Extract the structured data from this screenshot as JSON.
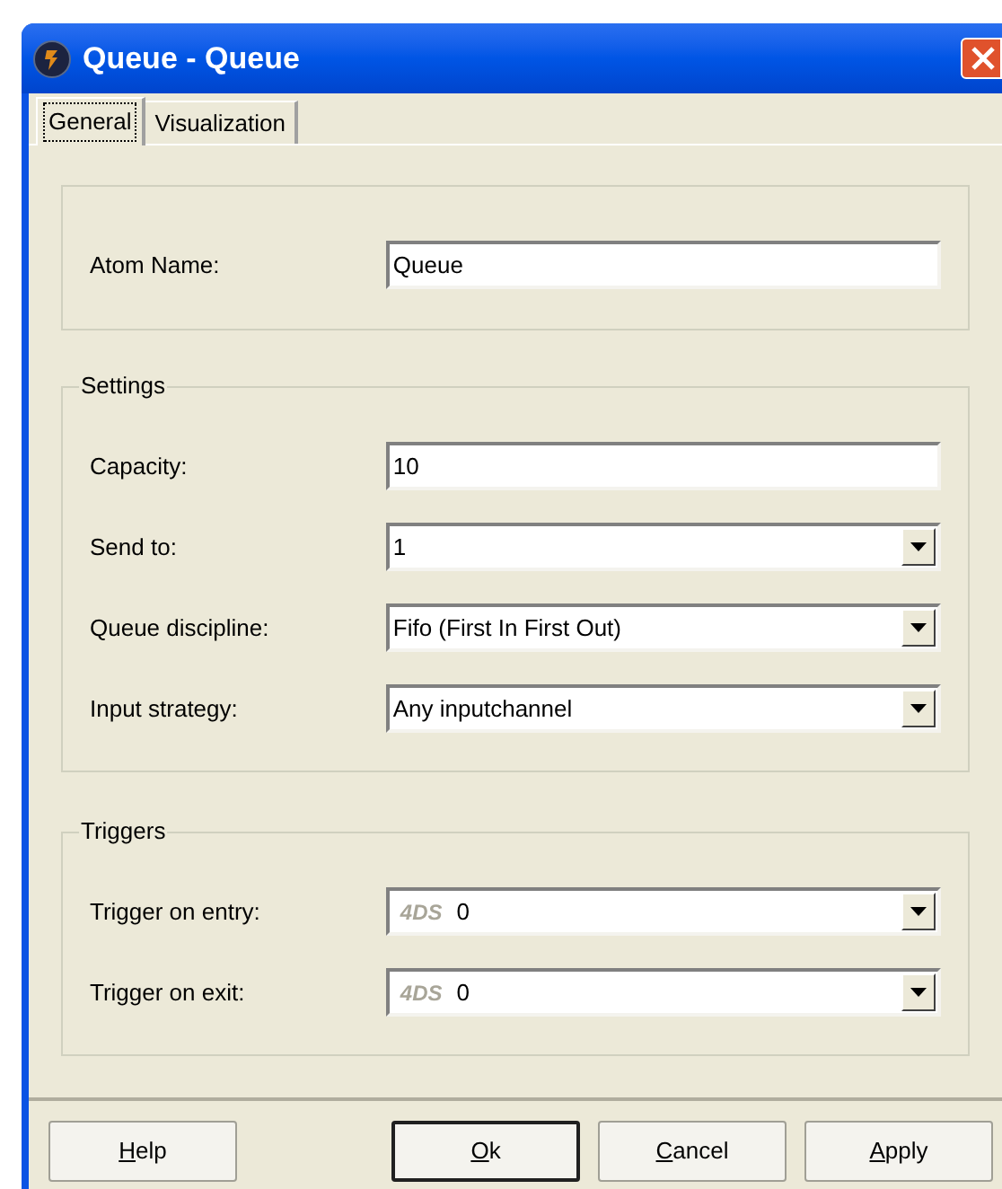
{
  "window": {
    "title": "Queue - Queue"
  },
  "tabs": [
    {
      "label": "General",
      "selected": true
    },
    {
      "label": "Visualization",
      "selected": false
    }
  ],
  "name_group": {
    "fields": [
      {
        "kind": "text",
        "label": "Atom Name:",
        "value": "Queue"
      }
    ]
  },
  "settings": {
    "title": "Settings",
    "fields": [
      {
        "kind": "text",
        "label": "Capacity:",
        "value": "10"
      },
      {
        "kind": "dropdown",
        "label": "Send to:",
        "value": "1"
      },
      {
        "kind": "dropdown",
        "label": "Queue discipline:",
        "value": "Fifo (First In First Out)"
      },
      {
        "kind": "dropdown",
        "label": "Input strategy:",
        "value": "Any inputchannel"
      }
    ]
  },
  "triggers": {
    "title": "Triggers",
    "fields": [
      {
        "kind": "code",
        "label": "Trigger on entry:",
        "prefix": "4DS",
        "value": "0"
      },
      {
        "kind": "code",
        "label": "Trigger on exit:",
        "prefix": "4DS",
        "value": "0"
      }
    ]
  },
  "buttons": [
    {
      "accel": "H",
      "rest": "elp",
      "default": false
    },
    {
      "accel": "O",
      "rest": "k",
      "default": true
    },
    {
      "accel": "C",
      "rest": "ancel",
      "default": false
    },
    {
      "accel": "A",
      "rest": "pply",
      "default": false
    }
  ]
}
